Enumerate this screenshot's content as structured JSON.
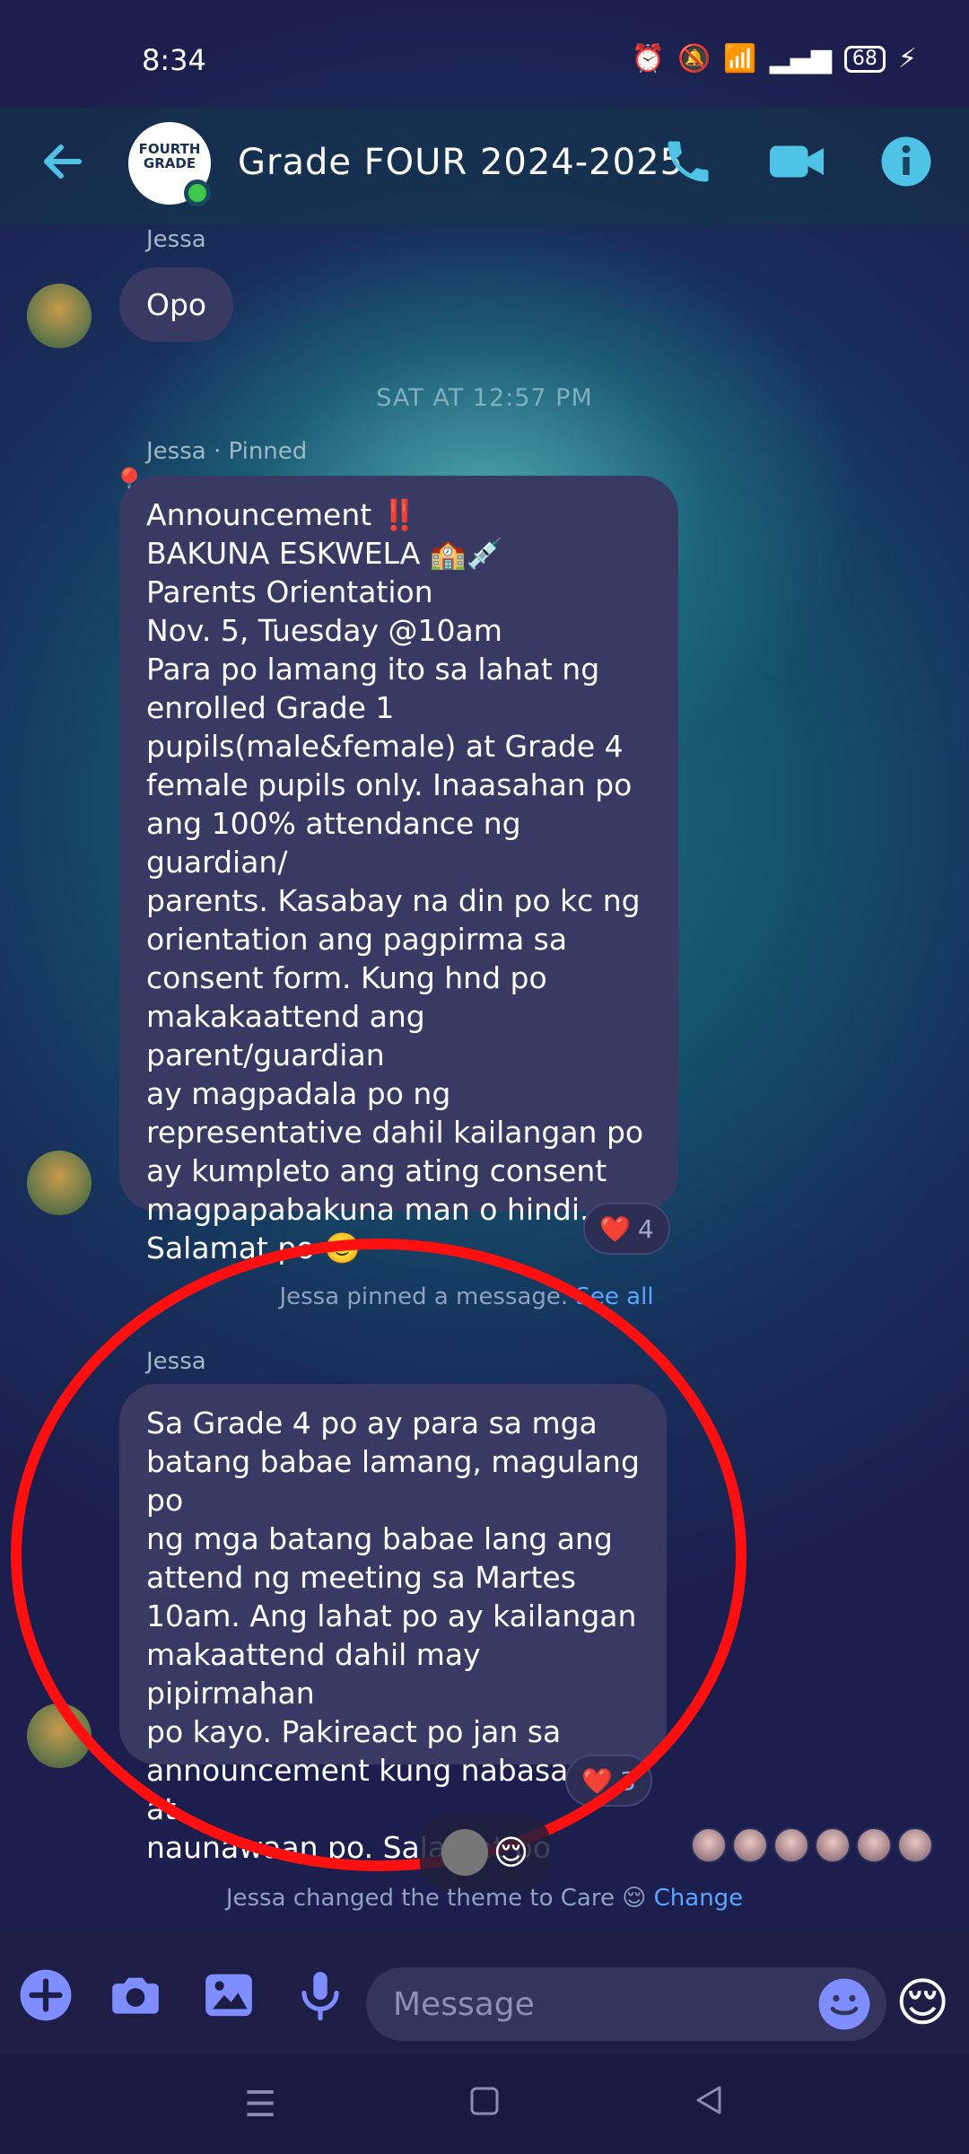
{
  "status": {
    "time": "8:34",
    "battery": "68"
  },
  "header": {
    "group_name": "Grade FOUR 2024-2025",
    "avatar_text": "FOURTH GRADE"
  },
  "messages": [
    {
      "sender": "Jessa",
      "text": "Opo"
    },
    {
      "separator": "SAT AT 12:57 PM"
    },
    {
      "sender": "Jessa · Pinned",
      "lines": [
        "Announcement ‼️",
        "BAKUNA ESKWELA 🏫💉",
        "Parents Orientation",
        "Nov. 5, Tuesday @10am",
        "Para po lamang ito sa lahat ng",
        "enrolled Grade 1",
        "pupils(male&female) at Grade 4",
        "female pupils only. Inaasahan po",
        "ang 100% attendance ng guardian/",
        "parents. Kasabay na din po kc ng",
        "orientation ang pagpirma sa",
        "consent form. Kung hnd po",
        "makakaattend ang parent/guardian",
        "ay magpadala po ng",
        "representative dahil kailangan po",
        "ay kumpleto ang ating consent",
        "magpapabakuna man o hindi.",
        "Salamat po 🙂"
      ],
      "reaction": {
        "emoji": "❤️",
        "count": "4"
      }
    },
    {
      "system": "Jessa pinned a message.",
      "link": "See all"
    },
    {
      "sender": "Jessa",
      "lines": [
        "Sa Grade 4 po ay para sa mga",
        "batang babae lamang, magulang po",
        "ng mga batang babae lang ang",
        "attend ng meeting sa Martes",
        "10am. Ang lahat po ay kailangan",
        "makaattend dahil may pipirmahan",
        "po kayo. Pakireact po jan sa",
        "announcement kung nabasa na at",
        "naunawaan po. Salamat po"
      ],
      "reaction": {
        "emoji": "❤️",
        "count": "3"
      }
    },
    {
      "system": "Jessa changed the theme to Care 😌",
      "link": "Change"
    }
  ],
  "floating": {
    "emoji": "😌"
  },
  "composer": {
    "placeholder": "Message",
    "quick_emoji": "😌"
  },
  "colors": {
    "bubble": "#393a63",
    "accent_header": "#4fc3e6",
    "accent_composer": "#7e8dff",
    "highlight_circle": "#ff1010"
  }
}
